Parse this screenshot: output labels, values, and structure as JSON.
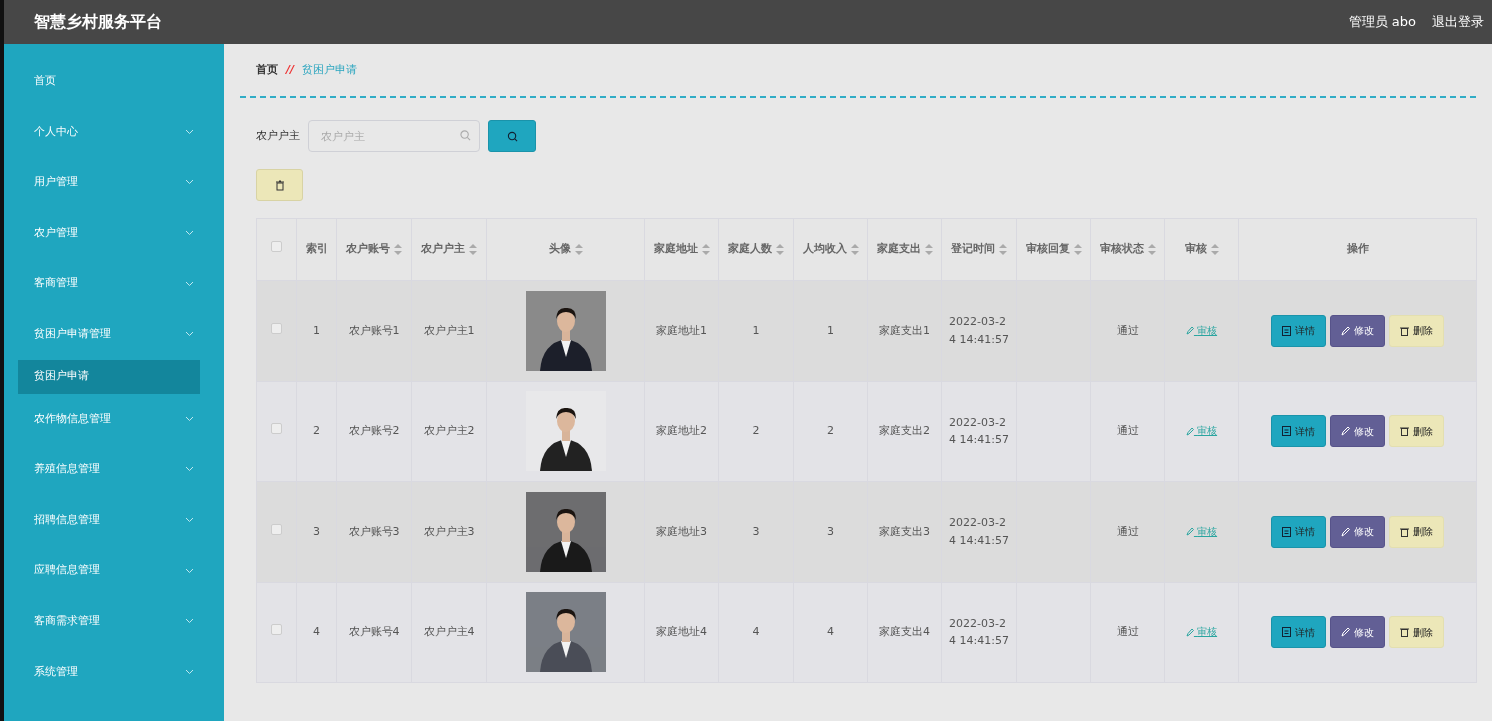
{
  "header": {
    "title": "智慧乡村服务平台",
    "user": "管理员 abo",
    "logout": "退出登录"
  },
  "sidebar": {
    "items": [
      {
        "label": "首页",
        "expandable": false,
        "selected": false
      },
      {
        "label": "个人中心",
        "expandable": true,
        "selected": false
      },
      {
        "label": "用户管理",
        "expandable": true,
        "selected": false
      },
      {
        "label": "农户管理",
        "expandable": true,
        "selected": false
      },
      {
        "label": "客商管理",
        "expandable": true,
        "selected": false
      },
      {
        "label": "贫困户申请管理",
        "expandable": true,
        "selected": false,
        "children": [
          {
            "label": "贫困户申请",
            "selected": true
          }
        ]
      },
      {
        "label": "农作物信息管理",
        "expandable": true,
        "selected": false
      },
      {
        "label": "养殖信息管理",
        "expandable": true,
        "selected": false
      },
      {
        "label": "招聘信息管理",
        "expandable": true,
        "selected": false
      },
      {
        "label": "应聘信息管理",
        "expandable": true,
        "selected": false
      },
      {
        "label": "客商需求管理",
        "expandable": true,
        "selected": false
      },
      {
        "label": "系统管理",
        "expandable": true,
        "selected": false
      }
    ]
  },
  "breadcrumb": {
    "home": "首页",
    "separator": "//",
    "current": "贫困户申请"
  },
  "search": {
    "label": "农户户主",
    "placeholder": "农户户主"
  },
  "table": {
    "columns": [
      {
        "kind": "check",
        "checked": false
      },
      {
        "label": "索引",
        "sortable": false
      },
      {
        "label": "农户账号",
        "sortable": true
      },
      {
        "label": "农户户主",
        "sortable": true
      },
      {
        "label": "头像",
        "sortable": true
      },
      {
        "label": "家庭地址",
        "sortable": true
      },
      {
        "label": "家庭人数",
        "sortable": true
      },
      {
        "label": "人均收入",
        "sortable": true
      },
      {
        "label": "家庭支出",
        "sortable": true
      },
      {
        "label": "登记时间",
        "sortable": true
      },
      {
        "label": "审核回复",
        "sortable": true
      },
      {
        "label": "审核状态",
        "sortable": true
      },
      {
        "label": "审核",
        "sortable": true
      },
      {
        "label": "操作",
        "sortable": false
      }
    ],
    "rows": [
      {
        "checked": false,
        "index": "1",
        "account": "农户账号1",
        "owner": "农户户主1",
        "address": "家庭地址1",
        "members": "1",
        "income": "1",
        "expense": "家庭支出1",
        "time": "2022-03-24 14:41:57",
        "status": "通过",
        "review": "审核",
        "actions": [
          "详情",
          "修改",
          "删除"
        ]
      },
      {
        "checked": false,
        "index": "2",
        "account": "农户账号2",
        "owner": "农户户主2",
        "address": "家庭地址2",
        "members": "2",
        "income": "2",
        "expense": "家庭支出2",
        "time": "2022-03-24 14:41:57",
        "status": "通过",
        "review": "审核",
        "actions": [
          "详情",
          "修改",
          "删除"
        ]
      },
      {
        "checked": false,
        "index": "3",
        "account": "农户账号3",
        "owner": "农户户主3",
        "address": "家庭地址3",
        "members": "3",
        "income": "3",
        "expense": "家庭支出3",
        "time": "2022-03-24 14:41:57",
        "status": "通过",
        "review": "审核",
        "actions": [
          "详情",
          "修改",
          "删除"
        ]
      },
      {
        "checked": false,
        "index": "4",
        "account": "农户账号4",
        "owner": "农户户主4",
        "address": "家庭地址4",
        "members": "4",
        "income": "4",
        "expense": "家庭支出4",
        "time": "2022-03-24 14:41:57",
        "status": "通过",
        "review": "审核",
        "actions": [
          "详情",
          "修改",
          "删除"
        ]
      }
    ]
  }
}
